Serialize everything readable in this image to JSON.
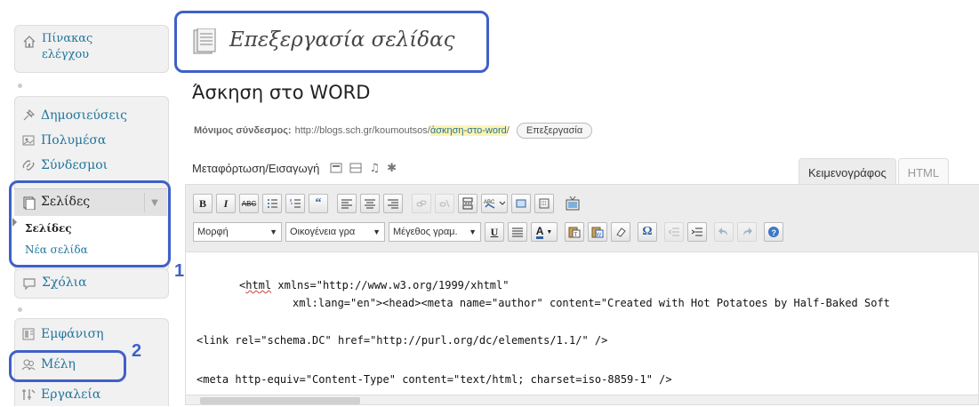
{
  "sidebar": {
    "dashboard": "Πίνακας ελέγχου",
    "posts": "Δημοσιεύσεις",
    "media": "Πολυμέσα",
    "links": "Σύνδεσμοι",
    "pages": "Σελίδες",
    "pages_sub": [
      "Σελίδες",
      "Νέα σελίδα"
    ],
    "comments": "Σχόλια",
    "appearance": "Εμφάνιση",
    "users": "Μέλη",
    "tools": "Εργαλεία"
  },
  "annotations": [
    "1",
    "2"
  ],
  "heading": "Επεξεργασία σελίδας",
  "title_value": "Άσκηση στο WORD",
  "permalink": {
    "label": "Μόνιμος σύνδεσμος:",
    "base": "http://blogs.sch.gr/koumoutsos/",
    "slug": "άσκηση-στο-word",
    "trail": "/",
    "edit_button": "Επεξεργασία"
  },
  "upload_label": "Μεταφόρτωση/Εισαγωγή",
  "tabs": [
    "Κειμενογράφος",
    "HTML"
  ],
  "toolbar": {
    "row1": [
      "B",
      "I",
      "ABC",
      "bullist",
      "numlist",
      "blockquote",
      "alignleft",
      "aligncenter",
      "alignright",
      "link",
      "unlink",
      "more",
      "spellcheck",
      "fullscreen",
      "kitchensink",
      "media"
    ],
    "format_select": "Μορφή",
    "font_family_select": "Οικογένεια γρα",
    "font_size_select": "Μέγεθος γραμ.",
    "row2_buttons": [
      "U",
      "justify",
      "A",
      "paste-text",
      "paste-word",
      "remove-format",
      "Ω",
      "outdent",
      "indent",
      "undo",
      "redo",
      "help"
    ]
  },
  "code": [
    "<html xmlns=\"http://www.w3.org/1999/xhtml\"",
    "xml:lang=\"en\"><head><meta name=\"author\" content=\"Created with Hot Potatoes by Half-Baked Soft",
    "<link rel=\"schema.DC\" href=\"http://purl.org/dc/elements/1.1/\" />",
    "<meta http-equiv=\"Content-Type\" content=\"text/html; charset=iso-8859-1\" />"
  ],
  "colors": {
    "link": "#21759b",
    "annotation": "#4060c8",
    "slug_highlight": "#fff3b0"
  }
}
